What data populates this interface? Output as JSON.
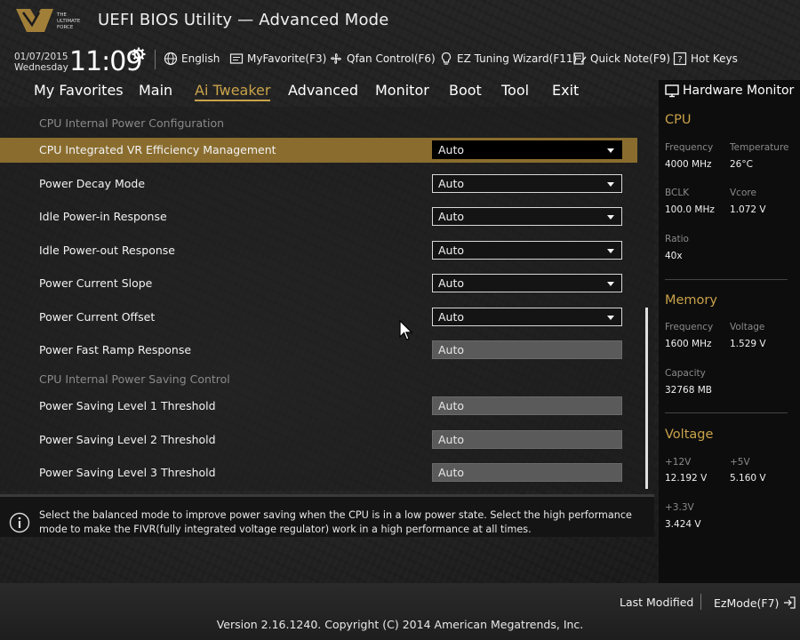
{
  "header": {
    "logo_text": "THE ULTIMATE FORCE",
    "title": "UEFI BIOS Utility — Advanced Mode"
  },
  "infobar": {
    "date": "01/07/2015",
    "day": "Wednesday",
    "time": "11:09",
    "items": [
      {
        "label": "English",
        "icon": "globe-icon"
      },
      {
        "label": "MyFavorite(F3)",
        "icon": "favorite-icon"
      },
      {
        "label": "Qfan Control(F6)",
        "icon": "fan-icon"
      },
      {
        "label": "EZ Tuning Wizard(F11)",
        "icon": "bulb-icon"
      },
      {
        "label": "Quick Note(F9)",
        "icon": "note-icon"
      },
      {
        "label": "Hot Keys",
        "icon": "help-icon"
      }
    ]
  },
  "menu": {
    "tabs": [
      "My Favorites",
      "Main",
      "Ai Tweaker",
      "Advanced",
      "Monitor",
      "Boot",
      "Tool",
      "Exit"
    ],
    "active": "Ai Tweaker"
  },
  "settings": {
    "section1": "CPU Internal Power Configuration",
    "rows": [
      {
        "label": "CPU Integrated VR Efficiency Management",
        "value": "Auto",
        "type": "dropdown"
      },
      {
        "label": "Power Decay Mode",
        "value": "Auto",
        "type": "dropdown"
      },
      {
        "label": "Idle Power-in Response",
        "value": "Auto",
        "type": "dropdown"
      },
      {
        "label": "Idle Power-out Response",
        "value": "Auto",
        "type": "dropdown"
      },
      {
        "label": "Power Current Slope",
        "value": "Auto",
        "type": "dropdown"
      },
      {
        "label": "Power Current Offset",
        "value": "Auto",
        "type": "dropdown"
      },
      {
        "label": "Power Fast Ramp Response",
        "value": "Auto",
        "type": "text"
      }
    ],
    "section2": "CPU Internal Power Saving Control",
    "rows2": [
      {
        "label": "Power Saving Level 1 Threshold",
        "value": "Auto"
      },
      {
        "label": "Power Saving Level 2 Threshold",
        "value": "Auto"
      },
      {
        "label": "Power Saving Level 3 Threshold",
        "value": "Auto"
      }
    ]
  },
  "help": {
    "text": "Select the balanced mode to improve power saving when the CPU is in a low power state. Select the high performance mode to make the FIVR(fully integrated voltage regulator) work in a high performance at all times."
  },
  "hardware_monitor": {
    "title": "Hardware Monitor",
    "cpu": {
      "label": "CPU",
      "frequency_label": "Frequency",
      "frequency": "4000 MHz",
      "temperature_label": "Temperature",
      "temperature": "26°C",
      "bclk_label": "BCLK",
      "bclk": "100.0 MHz",
      "vcore_label": "Vcore",
      "vcore": "1.072 V",
      "ratio_label": "Ratio",
      "ratio": "40x"
    },
    "memory": {
      "label": "Memory",
      "frequency_label": "Frequency",
      "frequency": "1600 MHz",
      "voltage_label": "Voltage",
      "voltage": "1.529 V",
      "capacity_label": "Capacity",
      "capacity": "32768 MB"
    },
    "voltage": {
      "label": "Voltage",
      "v12_label": "+12V",
      "v12": "12.192 V",
      "v5_label": "+5V",
      "v5": "5.160 V",
      "v33_label": "+3.3V",
      "v33": "3.424 V"
    }
  },
  "footer": {
    "last_modified": "Last Modified",
    "ezmode": "EzMode(F7)",
    "version": "Version 2.16.1240. Copyright (C) 2014 American Megatrends, Inc."
  },
  "colors": {
    "accent": "#c9a24a",
    "highlight_row": "#8a6d2e"
  }
}
